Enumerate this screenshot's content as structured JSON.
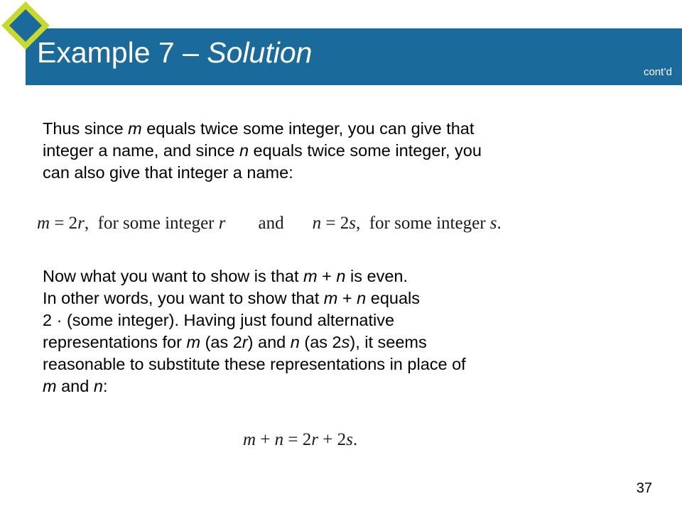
{
  "slide": {
    "page_number": "37",
    "colors": {
      "header_blue": "#1B6A9C",
      "logo_green": "#C8D92E",
      "logo_blue": "#1B6A9C",
      "text_black": "#000000",
      "background": "#FFFFFF"
    }
  },
  "header": {
    "title_main": "Example 7 – ",
    "title_emphasis": "Solution",
    "contd_label": "cont’d",
    "logo_icon": "diamond-logo-icon"
  },
  "body": {
    "paragraph1": {
      "seg1": "Thus since ",
      "var1": "m",
      "seg2": " equals twice some integer, you can give that\ninteger a name, and since ",
      "var2": "n",
      "seg3": " equals twice some integer, you\ncan also give that integer a name:"
    },
    "paragraph2": {
      "seg1": "Now what you want to show is that ",
      "var1": "m",
      "seg2": " + ",
      "var2": "n",
      "seg3": " is even.\nIn other words, you want to show that ",
      "var3": "m",
      "seg4": " + ",
      "var4": "n",
      "seg5": " equals\n2 · (some integer). Having just found alternative\nrepresentations for ",
      "var5": "m",
      "seg6": " (as 2",
      "var6": "r",
      "seg7": ") and ",
      "var7": "n",
      "seg8": " (as 2",
      "var8": "s",
      "seg9": "), it seems\nreasonable to substitute these representations in place of\n",
      "var9": "m",
      "seg10": " and ",
      "var10": "n",
      "seg11": ":"
    }
  },
  "equations": {
    "eq1": {
      "left_var": "m",
      "left_rest": " = 2",
      "left_sub": "r",
      "left_tail": ",  for some integer ",
      "left_name": "r",
      "conjunction": "and",
      "right_var": "n",
      "right_rest": " = 2",
      "right_sub": "s",
      "right_tail": ",  for some integer ",
      "right_name": "s",
      "right_end": "."
    },
    "eq2": {
      "v1": "m",
      "op1": " + ",
      "v2": "n",
      "eq": " = 2",
      "v3": "r",
      "op2": " + 2",
      "v4": "s",
      "end": "."
    }
  }
}
